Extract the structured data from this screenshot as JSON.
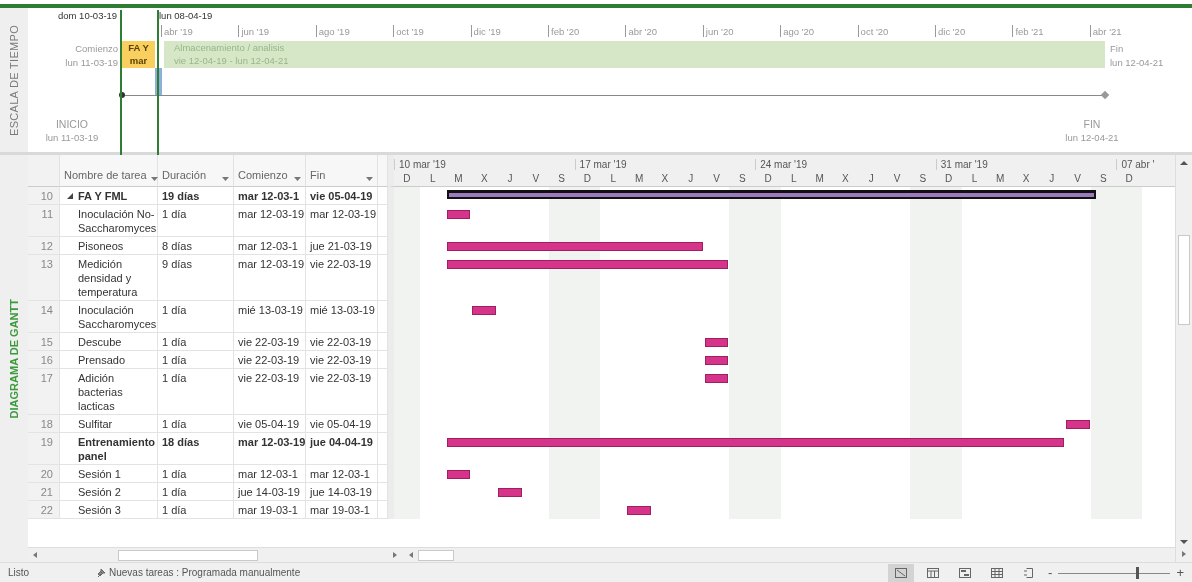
{
  "timeline": {
    "side_label": "ESCALA DE TIEMPO",
    "range_start": "dom 10-03-19",
    "range_end": "lun 08-04-19",
    "months": [
      "abr '19",
      "jun '19",
      "ago '19",
      "oct '19",
      "dic '19",
      "feb '20",
      "abr '20",
      "jun '20",
      "ago '20",
      "oct '20",
      "dic '20",
      "feb '21",
      "abr '21"
    ],
    "start": {
      "label": "Comienzo",
      "date": "lun 11-03-19"
    },
    "finish": {
      "label": "Fin",
      "date": "lun 12-04-21"
    },
    "bars": [
      {
        "kind": "bar",
        "title": "FA Y",
        "dates": "mar",
        "color": "#f9cf5f"
      },
      {
        "kind": "bar",
        "title": "Almacenamiento / analisis",
        "dates": "vie 12-04-19 - lun 12-04-21",
        "color": "#d6e7c8"
      },
      {
        "kind": "strip",
        "color": "#8db0da"
      }
    ],
    "milestones": [
      {
        "label": "INICIO",
        "date": "lun 11-03-19"
      },
      {
        "label": "FIN",
        "date": "lun 12-04-21"
      }
    ]
  },
  "gantt": {
    "side_label": "DIAGRAMA DE GANTT",
    "columns": [
      "Nombre de tarea",
      "Duración",
      "Comienzo",
      "Fin"
    ],
    "tasks": [
      {
        "id": "10",
        "name": "FA Y FML",
        "duration": "19 días",
        "start": "mar 12-03-1",
        "finish": "vie 05-04-19",
        "kind": "summary",
        "bold": true,
        "expanded": true,
        "children": [
          {
            "id": "11",
            "name": "Inoculación No-Saccharomyces",
            "duration": "1 día",
            "start": "mar 12-03-19",
            "finish": "mar 12-03-19",
            "kind": "task",
            "bold": false
          },
          {
            "id": "12",
            "name": "Pisoneos",
            "duration": "8 días",
            "start": "mar 12-03-1",
            "finish": "jue 21-03-19",
            "kind": "task",
            "bold": false
          },
          {
            "id": "13",
            "name": "Medición densidad y temperatura",
            "duration": "9 días",
            "start": "mar 12-03-19",
            "finish": "vie 22-03-19",
            "kind": "task",
            "bold": false
          },
          {
            "id": "14",
            "name": "Inoculación Saccharomyces",
            "duration": "1 día",
            "start": "mié 13-03-19",
            "finish": "mié 13-03-19",
            "kind": "task",
            "bold": false
          },
          {
            "id": "15",
            "name": "Descube",
            "duration": "1 día",
            "start": "vie 22-03-19",
            "finish": "vie 22-03-19",
            "kind": "task",
            "bold": false
          },
          {
            "id": "16",
            "name": "Prensado",
            "duration": "1 día",
            "start": "vie 22-03-19",
            "finish": "vie 22-03-19",
            "kind": "task",
            "bold": false
          },
          {
            "id": "17",
            "name": "Adición bacterias lacticas",
            "duration": "1 día",
            "start": "vie 22-03-19",
            "finish": "vie 22-03-19",
            "kind": "task",
            "bold": false
          },
          {
            "id": "18",
            "name": "Sulfitar",
            "duration": "1 día",
            "start": "vie 05-04-19",
            "finish": "vie 05-04-19",
            "kind": "task",
            "bold": false
          },
          {
            "id": "19",
            "name": "Entrenamiento panel",
            "duration": "18 días",
            "start": "mar 12-03-19",
            "finish": "jue 04-04-19",
            "kind": "task",
            "bold": true
          },
          {
            "id": "20",
            "name": "Sesión 1",
            "duration": "1 día",
            "start": "mar 12-03-1",
            "finish": "mar 12-03-1",
            "kind": "task",
            "bold": false
          },
          {
            "id": "21",
            "name": "Sesión 2",
            "duration": "1 día",
            "start": "jue 14-03-19",
            "finish": "jue 14-03-19",
            "kind": "task",
            "bold": false
          },
          {
            "id": "22",
            "name": "Sesión 3",
            "duration": "1 día",
            "start": "mar 19-03-1",
            "finish": "mar 19-03-1",
            "kind": "task",
            "bold": false
          }
        ]
      }
    ],
    "chart": {
      "weeks": [
        {
          "label": "10 mar '19",
          "days": [
            "D",
            "L",
            "M",
            "X",
            "J",
            "V",
            "S"
          ]
        },
        {
          "label": "17 mar '19",
          "days": [
            "D",
            "L",
            "M",
            "X",
            "J",
            "V",
            "S"
          ]
        },
        {
          "label": "24 mar '19",
          "days": [
            "D",
            "L",
            "M",
            "X",
            "J",
            "V",
            "S"
          ]
        },
        {
          "label": "31 mar '19",
          "days": [
            "D",
            "L",
            "M",
            "X",
            "J",
            "V",
            "S"
          ]
        },
        {
          "label": "07 abr '",
          "days": [
            "D"
          ]
        }
      ]
    }
  },
  "status_bar": {
    "mode": "Listo",
    "new_tasks": "Nuevas tareas : Programada manualmente",
    "views": [
      {
        "kind": "gantt",
        "selected": true
      },
      {
        "kind": "sheet",
        "selected": false
      },
      {
        "kind": "planner",
        "selected": false
      },
      {
        "kind": "grid",
        "selected": false
      },
      {
        "kind": "report",
        "selected": false
      }
    ],
    "zoom": {
      "minus": "-",
      "plus": "+",
      "level": 0.7
    }
  }
}
